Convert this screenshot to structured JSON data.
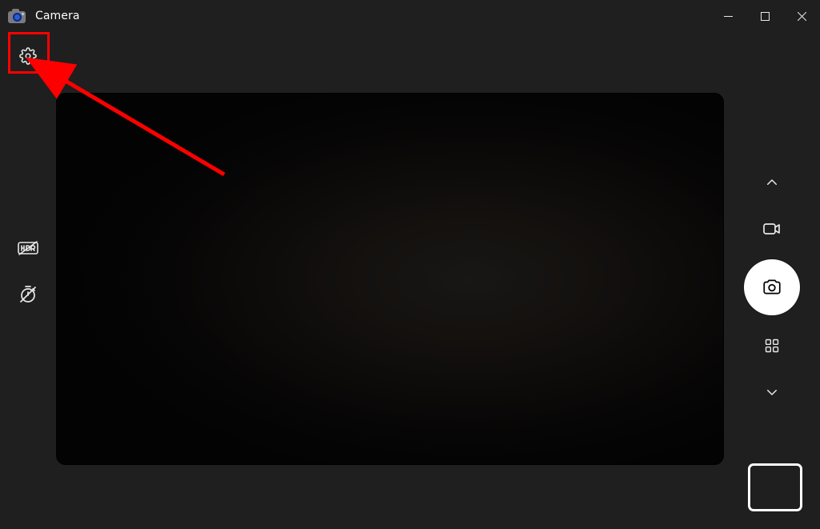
{
  "window": {
    "title": "Camera"
  },
  "icons": {
    "app": "camera-app-icon",
    "settings": "gear-icon",
    "hdr_off": "hdr-off-icon",
    "timer_off": "timer-off-icon",
    "minimize": "minimize-icon",
    "maximize": "maximize-icon",
    "close": "close-icon",
    "mode_up": "chevron-up-icon",
    "mode_down": "chevron-down-icon",
    "video_mode": "video-camera-icon",
    "shutter": "camera-icon",
    "barcode": "qr-code-icon",
    "gallery": "gallery-thumbnail"
  },
  "annotation": {
    "highlight": "settings-button-highlight",
    "arrow": "red-arrow"
  }
}
